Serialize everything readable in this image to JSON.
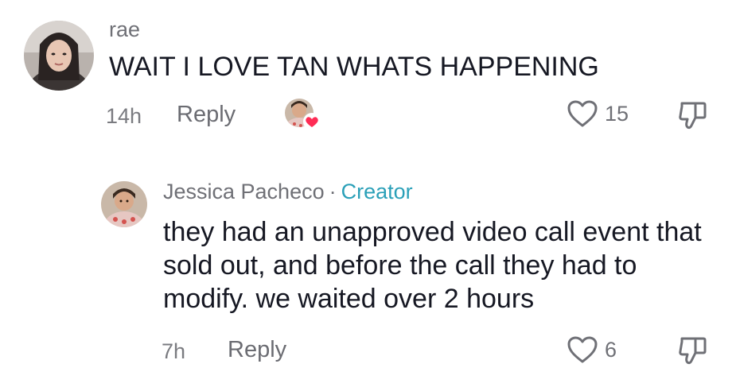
{
  "comments": [
    {
      "username": "rae",
      "text": "WAIT I LOVE TAN WHATS HAPPENING",
      "time": "14h",
      "reply_label": "Reply",
      "likes": "15"
    }
  ],
  "reply": {
    "username": "Jessica Pacheco",
    "separator": "·",
    "badge": "Creator",
    "text": "they had an unapproved video call event that sold out, and before the call they had to modify. we waited over 2 hours",
    "time": "7h",
    "reply_label": "Reply",
    "likes": "6"
  },
  "colors": {
    "creator_badge": "#2ba0b8",
    "heart_badge": "#fe2c55"
  }
}
